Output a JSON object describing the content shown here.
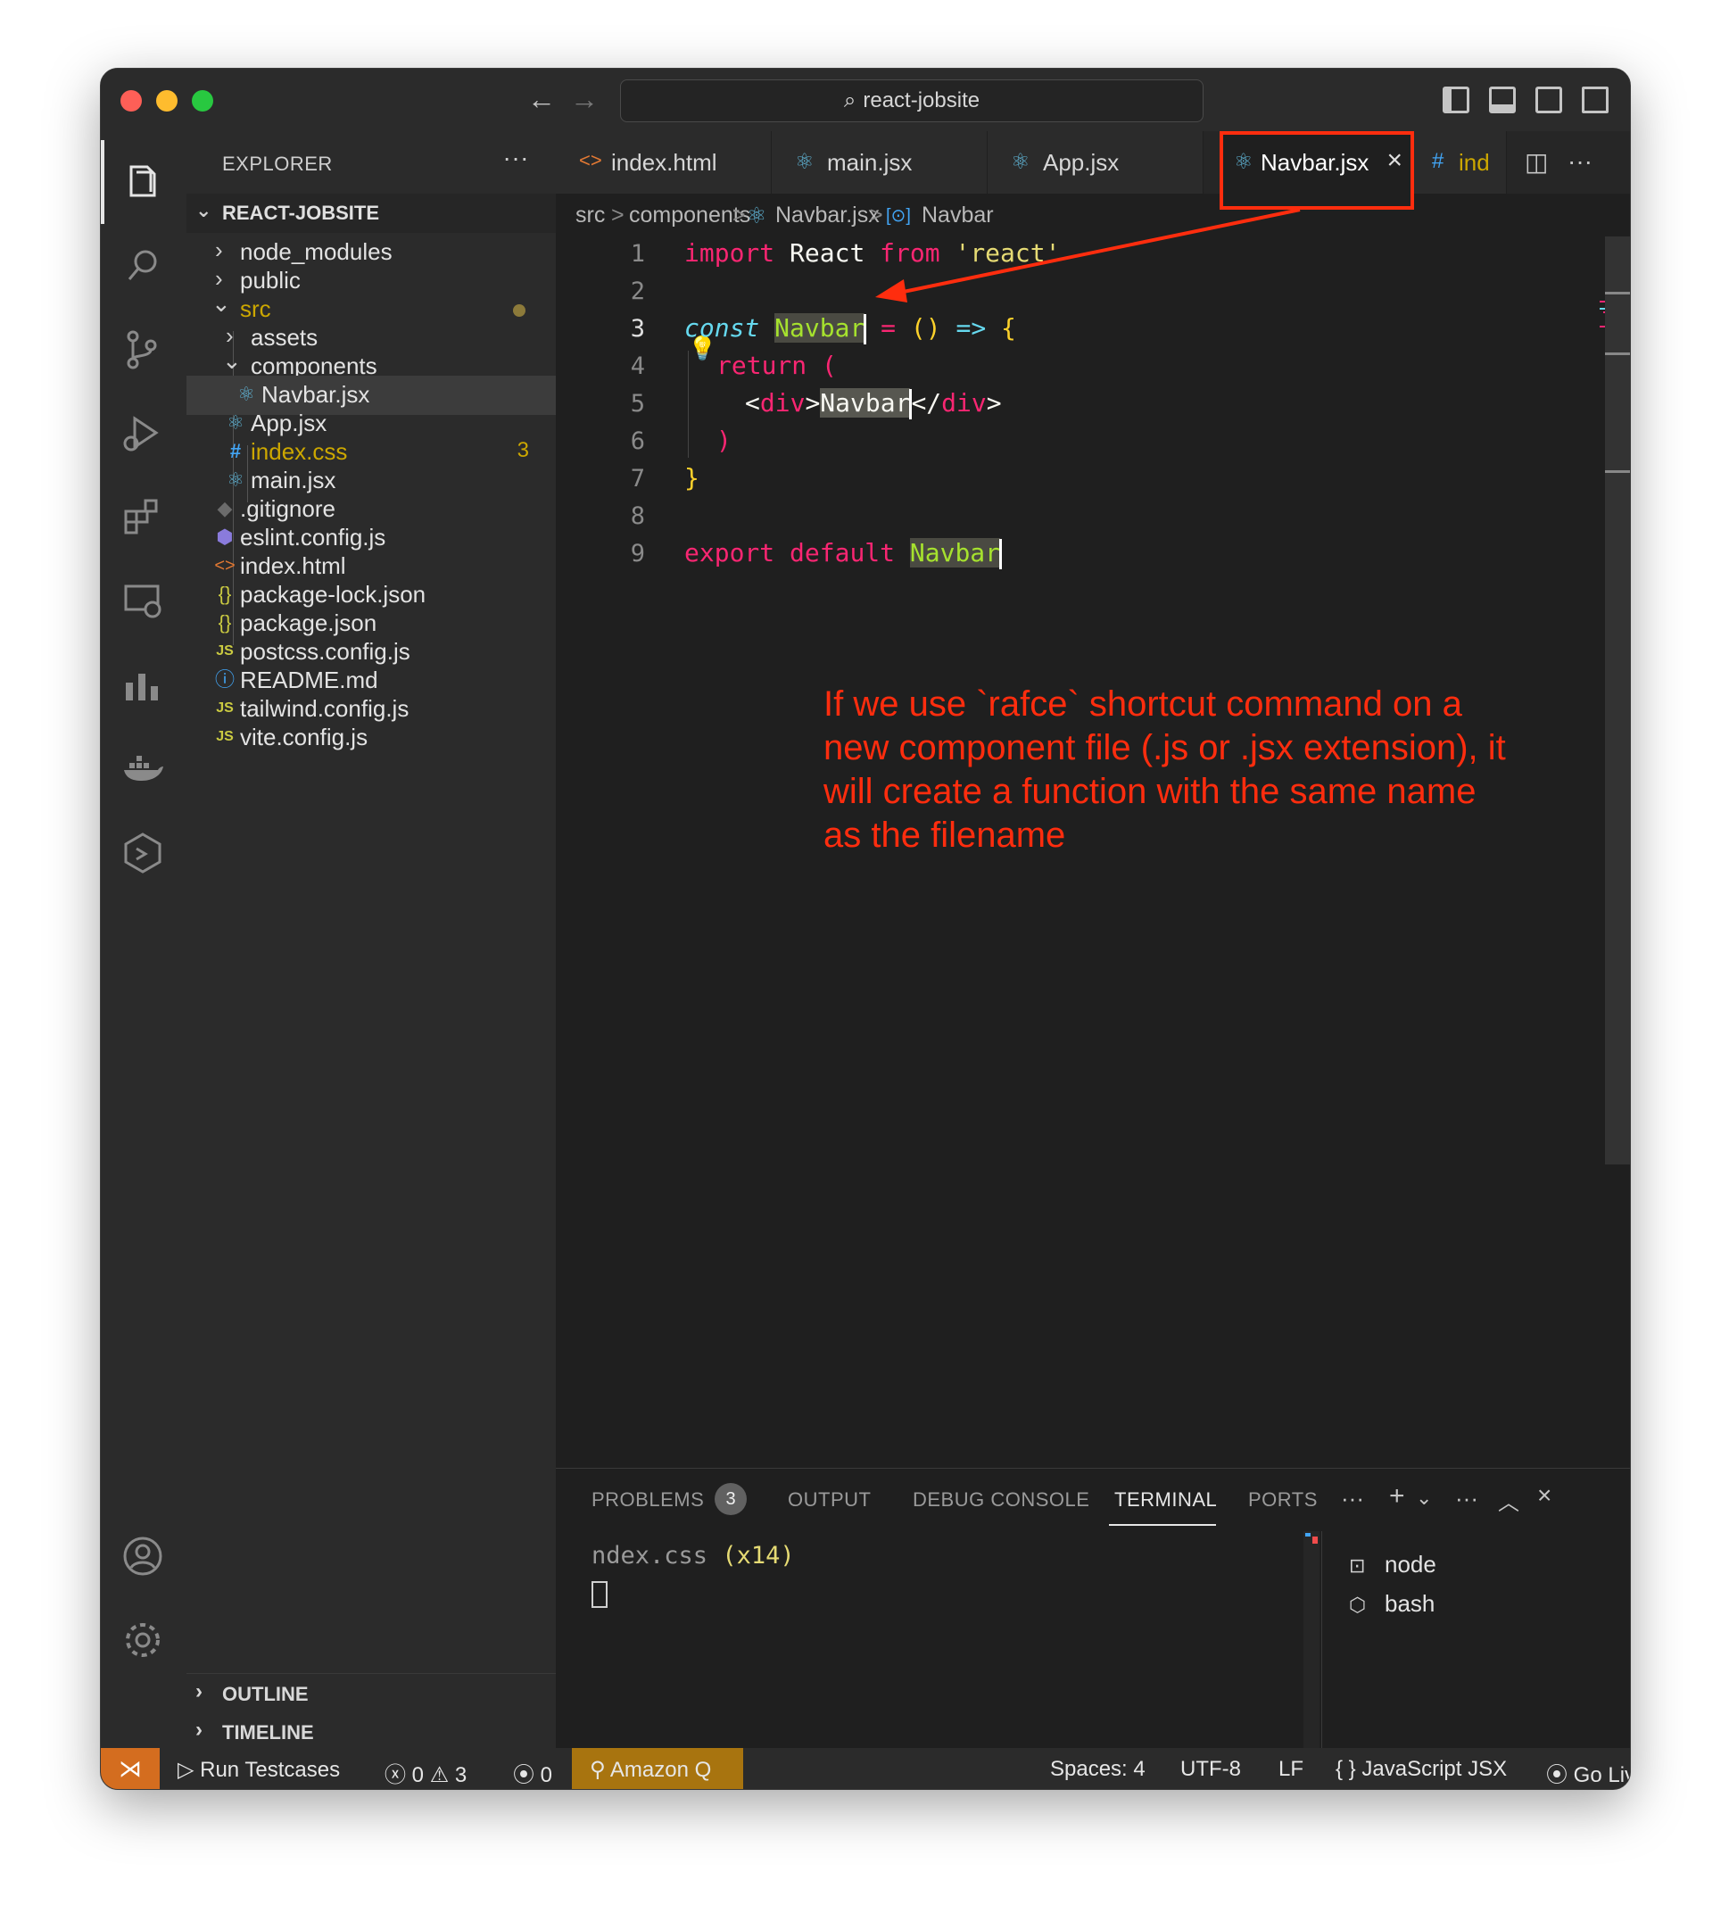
{
  "window": {
    "search_text": "react-jobsite"
  },
  "sidebar": {
    "header": "EXPLORER",
    "more": "···",
    "root": "REACT-JOBSITE",
    "items": [
      {
        "label": "node_modules",
        "icon": "chevron-right-icon"
      },
      {
        "label": "public",
        "icon": "chevron-right-icon"
      },
      {
        "label": "src",
        "icon": "chevron-down-icon"
      },
      {
        "label": "assets",
        "icon": "chevron-right-icon"
      },
      {
        "label": "components",
        "icon": "chevron-down-icon"
      },
      {
        "label": "Navbar.jsx",
        "icon": "react-icon"
      },
      {
        "label": "App.jsx",
        "icon": "react-icon"
      },
      {
        "label": "index.css",
        "icon": "hash-icon",
        "badge": "3"
      },
      {
        "label": "main.jsx",
        "icon": "react-icon"
      },
      {
        "label": ".gitignore",
        "icon": "git-icon"
      },
      {
        "label": "eslint.config.js",
        "icon": "eslint-icon"
      },
      {
        "label": "index.html",
        "icon": "html-icon"
      },
      {
        "label": "package-lock.json",
        "icon": "json-icon"
      },
      {
        "label": "package.json",
        "icon": "json-icon"
      },
      {
        "label": "postcss.config.js",
        "icon": "js-icon"
      },
      {
        "label": "README.md",
        "icon": "info-icon"
      },
      {
        "label": "tailwind.config.js",
        "icon": "js-icon"
      },
      {
        "label": "vite.config.js",
        "icon": "js-icon"
      }
    ],
    "outline": "OUTLINE",
    "timeline": "TIMELINE"
  },
  "tabs": [
    {
      "label": "index.html",
      "icon": "<>"
    },
    {
      "label": "main.jsx",
      "icon": "⚛"
    },
    {
      "label": "App.jsx",
      "icon": "⚛"
    },
    {
      "label": "Navbar.jsx",
      "icon": "⚛",
      "active": true
    },
    {
      "label": "ind",
      "icon": "#"
    }
  ],
  "breadcrumb": [
    "src",
    ">",
    "components",
    ">",
    "Navbar.jsx",
    ">",
    "Navbar"
  ],
  "editor": {
    "line_numbers": [
      "1",
      "2",
      "3",
      "4",
      "5",
      "6",
      "7",
      "8",
      "9"
    ],
    "code": {
      "l1_import": "import",
      "l1_react": " React ",
      "l1_from": "from",
      "l1_str": " 'react'",
      "l3_const": "const",
      "l3_name": "Navbar",
      "l3_eq": " = ",
      "l3_paren": "()",
      "l3_arrow": " => ",
      "l3_brace": "{",
      "l4_return": "return",
      "l4_paren": " (",
      "l5_lt": "<",
      "l5_div": "div",
      "l5_gt": ">",
      "l5_text": "Navbar",
      "l5_close_lt": "</",
      "l5_close_div": "div",
      "l5_close_gt": ">",
      "l6_paren": ")",
      "l7_brace": "}",
      "l9_export": "export",
      "l9_default": " default ",
      "l9_name": "Navbar"
    },
    "annotation": "If we use `rafce` shortcut command on a new component file (.js or .jsx extension), it will create a function with the same name as the filename"
  },
  "panel": {
    "tabs": [
      "PROBLEMS",
      "OUTPUT",
      "DEBUG CONSOLE",
      "TERMINAL",
      "PORTS"
    ],
    "problems_count": "3",
    "active_tab": "TERMINAL",
    "terminal_text_a": "ndex.css ",
    "terminal_text_b": "(x14)",
    "terminals": [
      "node",
      "bash"
    ]
  },
  "statusbar": {
    "run": "Run Testcases",
    "errors": "0",
    "warnings": "3",
    "ports": "0",
    "amazon_q": "Amazon Q",
    "spaces": "Spaces: 4",
    "encoding": "UTF-8",
    "eol": "LF",
    "language": "JavaScript JSX",
    "go_live": "Go Live"
  },
  "colors": {
    "highlight_red": "#ff2d0e",
    "remote_orange": "#d46d1f",
    "amazon_q_bg": "#a8740f"
  }
}
